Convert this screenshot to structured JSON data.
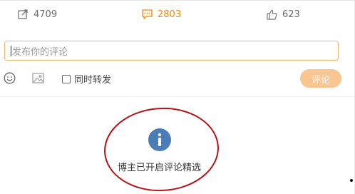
{
  "stats": {
    "repost": {
      "icon": "share-icon",
      "count": "4709"
    },
    "comment": {
      "icon": "comment-icon",
      "count": "2803"
    },
    "like": {
      "icon": "thumbs-up-icon",
      "count": "623"
    }
  },
  "composer": {
    "placeholder": "发布你的评论",
    "emoji_icon": "smiley-icon",
    "image_icon": "image-icon",
    "sync_label": "同时转发",
    "sync_checked": false,
    "submit_label": "评论"
  },
  "notice": {
    "icon": "info-icon",
    "text": "博主已开启评论精选"
  },
  "colors": {
    "accent": "#ff8200",
    "submit_bg": "#f9c590",
    "info_blue": "#4a7db5",
    "annotation_red": "#b3141a"
  }
}
